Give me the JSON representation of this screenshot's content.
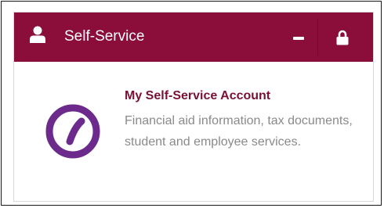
{
  "panel": {
    "title": "Self-Service",
    "header_icon": "user-icon",
    "controls": [
      "minus-icon",
      "lock-icon"
    ]
  },
  "link": {
    "title": "My Self-Service Account",
    "description": "Financial aid information, tax documents, student and employee services.",
    "logo_icon": "ellucian-logo-icon"
  },
  "colors": {
    "header_bg": "#8a0d3a",
    "header_text": "#ffffff",
    "link_title": "#7a1134",
    "description": "#8a8a8a",
    "logo": "#6b2a8c"
  }
}
